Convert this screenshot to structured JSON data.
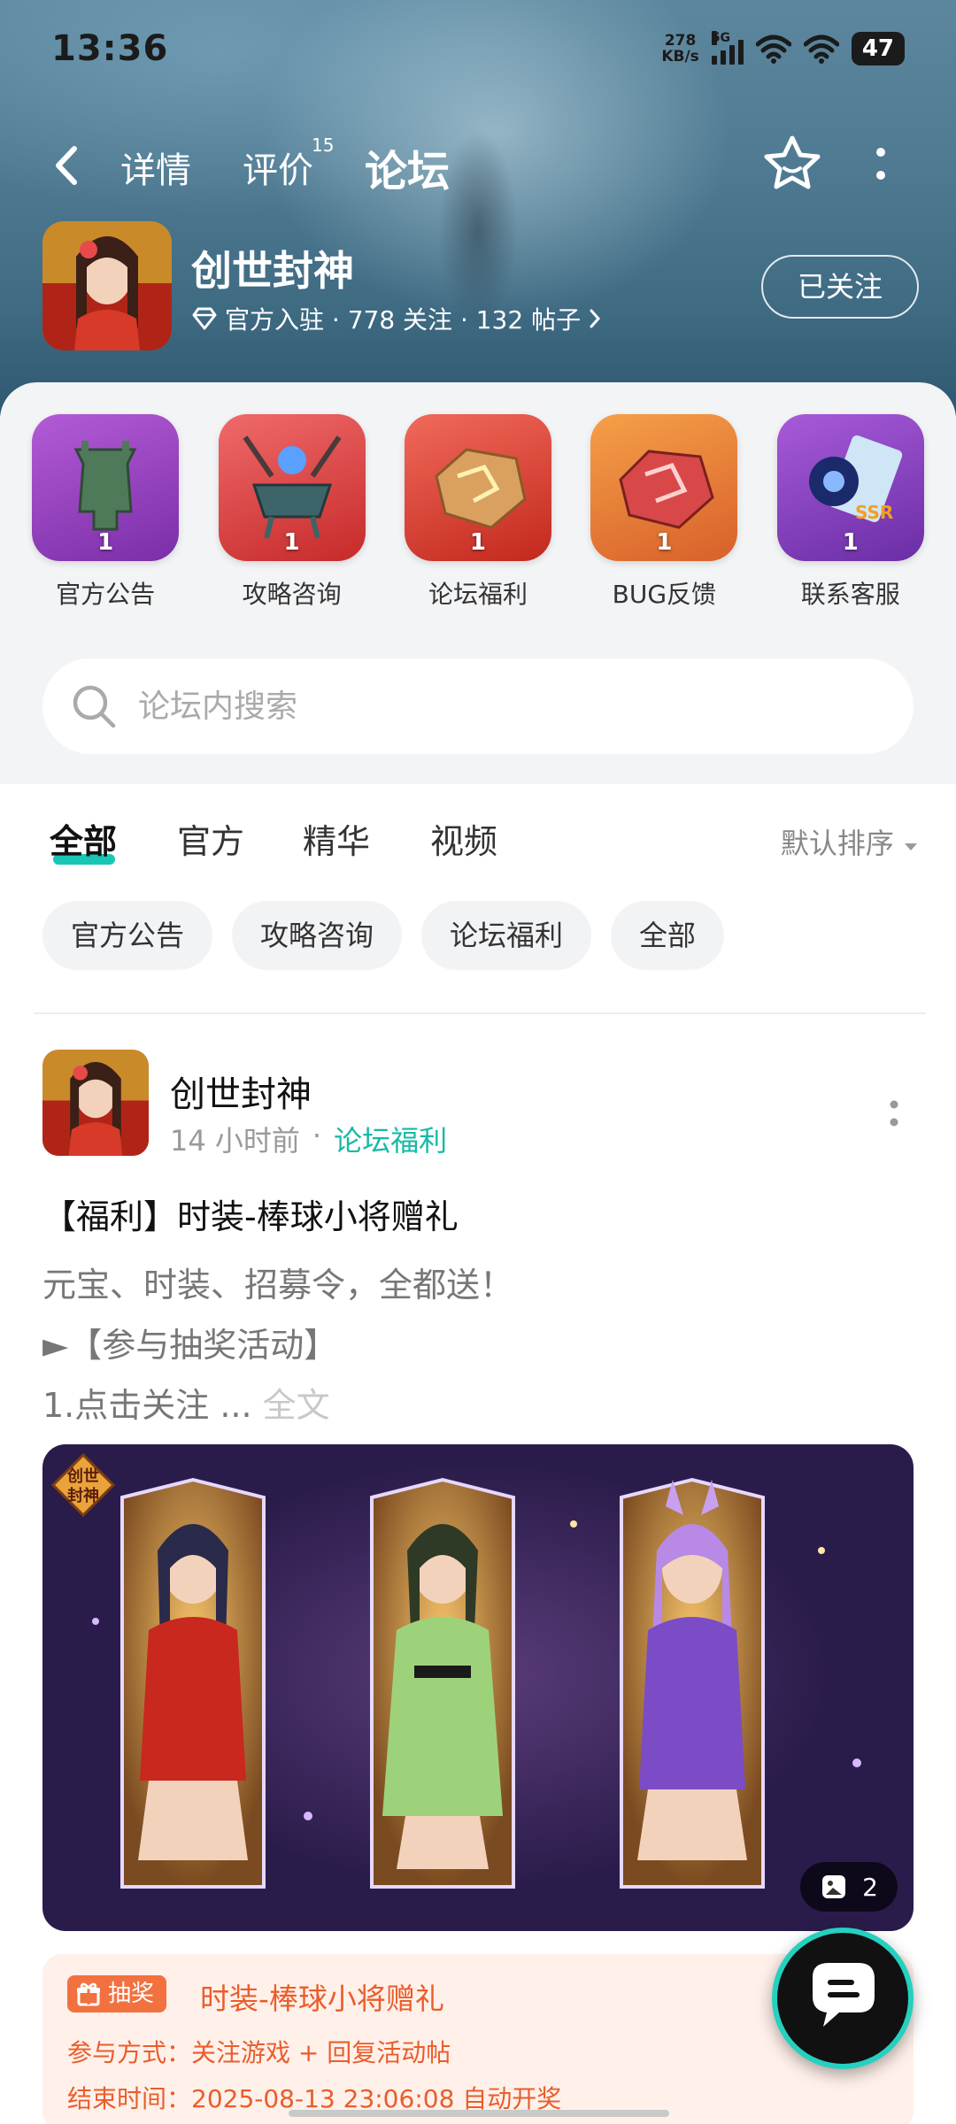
{
  "status_bar": {
    "time": "13:36",
    "net_speed_value": "278",
    "net_speed_unit": "KB/s",
    "signal_label": "5G",
    "battery": "47"
  },
  "nav": {
    "tabs": [
      {
        "label": "详情"
      },
      {
        "label": "评价",
        "badge": "15"
      },
      {
        "label": "论坛",
        "active": true
      }
    ]
  },
  "game": {
    "name": "创世封神",
    "stats": "官方入驻 · 778 关注 · 132 帖子",
    "follow_label": "已关注"
  },
  "shortcuts": [
    {
      "label": "官方公告",
      "count": "1",
      "icon": "bronze-vessel-icon"
    },
    {
      "label": "攻略咨询",
      "count": "1",
      "icon": "cauldron-icon"
    },
    {
      "label": "论坛福利",
      "count": "1",
      "icon": "golden-ore-icon"
    },
    {
      "label": "BUG反馈",
      "count": "1",
      "icon": "red-ore-icon"
    },
    {
      "label": "联系客服",
      "count": "1",
      "icon": "ssr-card-icon"
    }
  ],
  "search": {
    "placeholder": "论坛内搜索"
  },
  "filter_tabs": [
    {
      "label": "全部",
      "active": true
    },
    {
      "label": "官方"
    },
    {
      "label": "精华"
    },
    {
      "label": "视频"
    }
  ],
  "sort_label": "默认排序",
  "chips": [
    "官方公告",
    "攻略咨询",
    "论坛福利",
    "全部"
  ],
  "post": {
    "author": "创世封神",
    "time": "14 小时前",
    "separator": "·",
    "category": "论坛福利",
    "title": "【福利】时装-棒球小将赠礼",
    "body_line1": "元宝、时装、招募令，全都送！",
    "body_line2": "►【参与抽奖活动】",
    "body_line3": "1.点击关注 ...",
    "more_label": "全文",
    "image_count": "2",
    "image_logo": "创世封神",
    "lottery": {
      "badge": "抽奖",
      "title": "时装-棒球小将赠礼",
      "method": "参与方式：关注游戏 + 回复活动帖",
      "end_time": "结束时间：2025-08-13 23:06:08 自动开奖"
    }
  }
}
